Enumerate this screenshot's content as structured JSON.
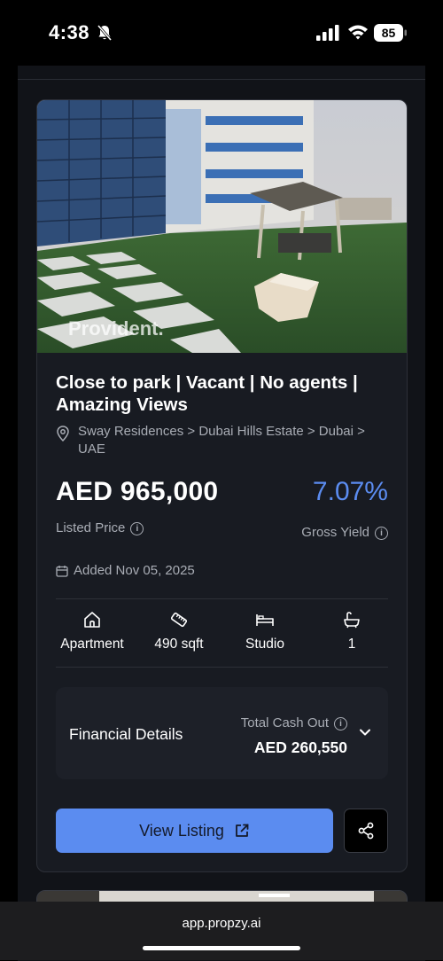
{
  "status": {
    "time": "4:38",
    "battery": "85"
  },
  "listing": {
    "title": "Close to park | Vacant | No agents | Amazing Views",
    "location": "Sway Residences > Dubai Hills Estate > Dubai > UAE",
    "price": "AED 965,000",
    "price_label": "Listed Price",
    "yield": "7.07%",
    "yield_label": "Gross Yield",
    "added": "Added Nov 05, 2025",
    "watermark": "Provident.",
    "features": [
      {
        "icon": "home-icon",
        "label": "Apartment"
      },
      {
        "icon": "ruler-icon",
        "label": "490 sqft"
      },
      {
        "icon": "bed-icon",
        "label": "Studio"
      },
      {
        "icon": "bath-icon",
        "label": "1"
      }
    ],
    "financial": {
      "label": "Financial Details",
      "cash_label": "Total Cash Out",
      "cash_value": "AED 260,550"
    },
    "view_button": "View Listing"
  },
  "browser": {
    "url": "app.propzy.ai"
  },
  "colors": {
    "accent": "#5b8cf0",
    "card": "#181b22",
    "page": "#111318"
  }
}
